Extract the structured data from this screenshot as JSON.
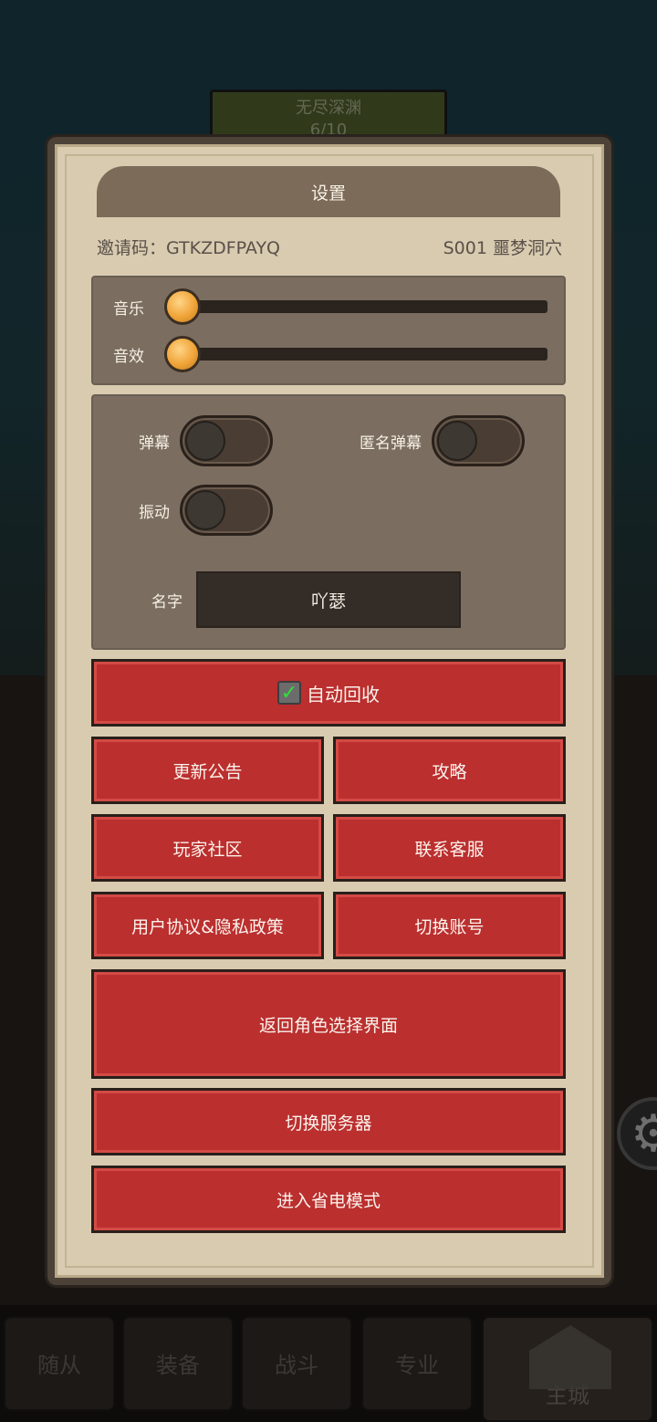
{
  "background": {
    "stage_title": "无尽深渊",
    "stage_progress": "6/10",
    "nav_tabs": [
      "随从",
      "装备",
      "战斗",
      "专业",
      "主城"
    ]
  },
  "settings": {
    "title": "设置",
    "invite_code": "邀请码：GTKZDFPAYQ",
    "server": "S001 噩梦洞穴",
    "audio": {
      "music_label": "音乐",
      "music_level": 0,
      "sfx_label": "音效",
      "sfx_level": 0
    },
    "toggles": {
      "danmaku_label": "弹幕",
      "danmaku_on": false,
      "anon_danmaku_label": "匿名弹幕",
      "anon_danmaku_on": false,
      "vibration_label": "振动",
      "vibration_on": false
    },
    "name_label": "名字",
    "name_value": "吖瑟",
    "buttons": {
      "auto_recycle": "自动回收",
      "auto_recycle_checked": true,
      "update_notice": "更新公告",
      "guide": "攻略",
      "community": "玩家社区",
      "support": "联系客服",
      "agreement": "用户协议&隐私政策",
      "switch_account": "切换账号",
      "back_to_role": "返回角色选择界面",
      "switch_server": "切换服务器",
      "power_save": "进入省电模式"
    }
  }
}
